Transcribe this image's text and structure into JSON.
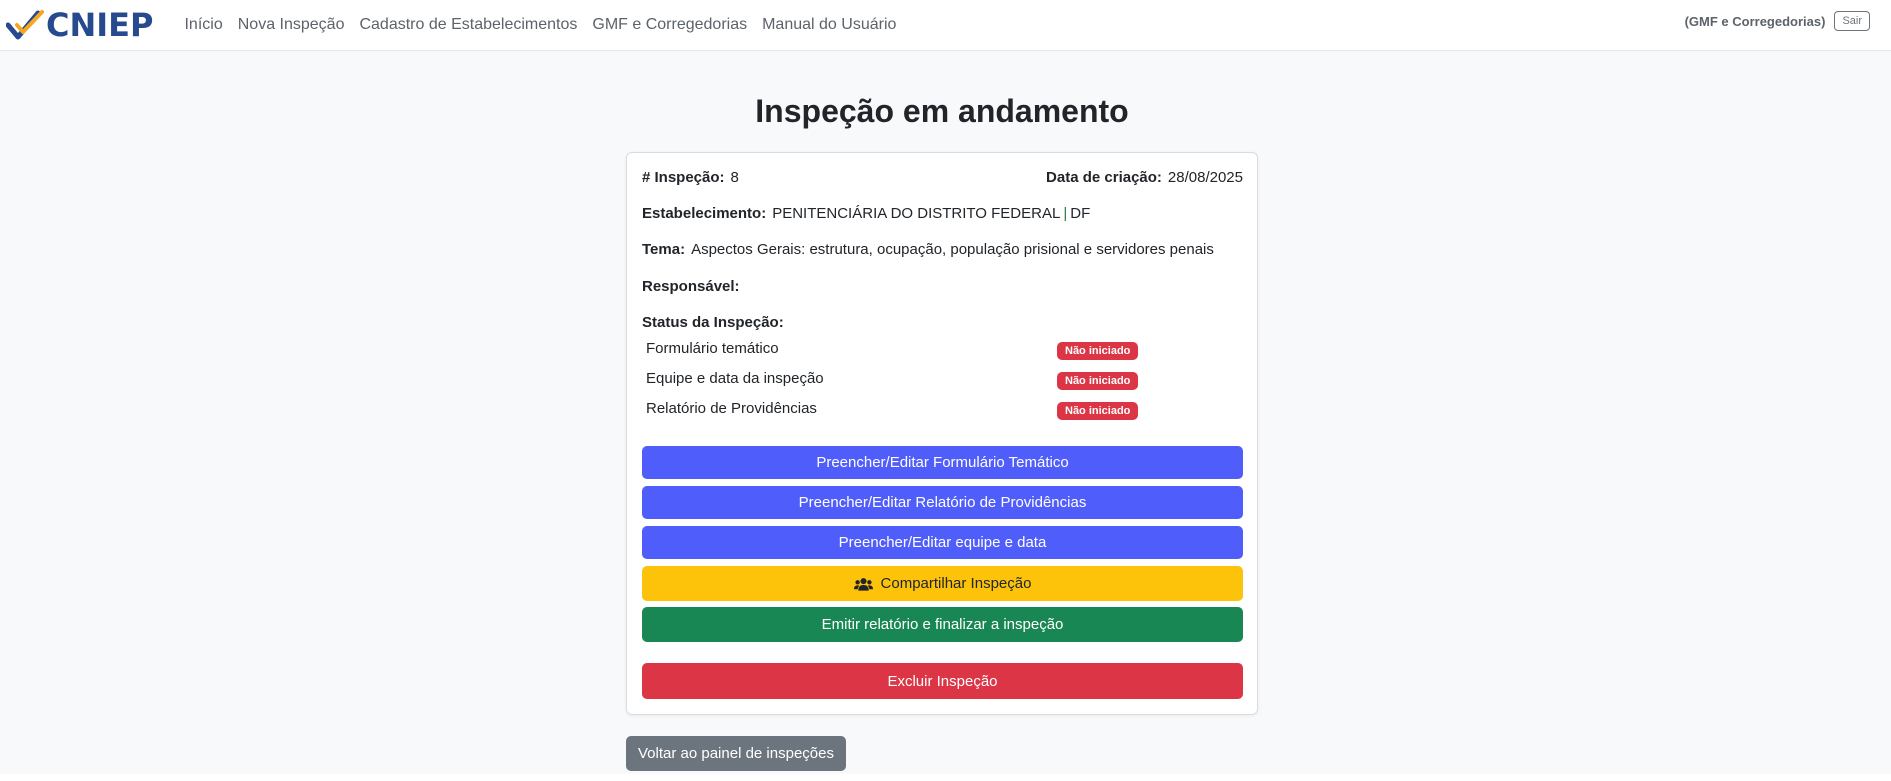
{
  "brand": {
    "name": "CNIEP"
  },
  "nav": {
    "links": [
      "Início",
      "Nova Inspeção",
      "Cadastro de Estabelecimentos",
      "GMF e Corregedorias",
      "Manual do Usuário"
    ],
    "user_label": "(GMF e Corregedorias)",
    "logout_label": "Sair"
  },
  "page": {
    "title": "Inspeção em andamento"
  },
  "inspection": {
    "id_label": "# Inspeção:",
    "id_value": "8",
    "created_label": "Data de criação:",
    "created_value": "28/08/2025",
    "establishment_label": "Estabelecimento:",
    "establishment_name": "PENITENCIÁRIA DO DISTRITO FEDERAL",
    "establishment_separator": "|",
    "establishment_uf": "DF",
    "theme_label": "Tema:",
    "theme_value": "Aspectos Gerais: estrutura, ocupação, população prisional e servidores penais",
    "responsible_label": "Responsável:",
    "status_label": "Status da Inspeção:",
    "status_items": [
      {
        "label": "Formulário temático",
        "status": "Não iniciado"
      },
      {
        "label": "Equipe e data da inspeção",
        "status": "Não iniciado"
      },
      {
        "label": "Relatório de Providências",
        "status": "Não iniciado"
      }
    ],
    "status_color": "#dc3545"
  },
  "actions": {
    "fill_form": "Preencher/Editar Formulário Temático",
    "fill_report": "Preencher/Editar Relatório de Providências",
    "fill_team": "Preencher/Editar equipe e data",
    "share": "Compartilhar Inspeção",
    "finalize": "Emitir relatório e finalizar a inspeção",
    "delete": "Excluir Inspeção",
    "back": "Voltar ao painel de inspeções"
  },
  "colors": {
    "brand": "#274a8f",
    "brand_check": "#f5a623",
    "primary": "#4f5efb",
    "warning": "#fdc30b",
    "success": "#198754",
    "danger": "#dc3545",
    "secondary": "#6c757d"
  },
  "icons": {
    "share": "users-icon",
    "logo": "check-logo-icon"
  }
}
